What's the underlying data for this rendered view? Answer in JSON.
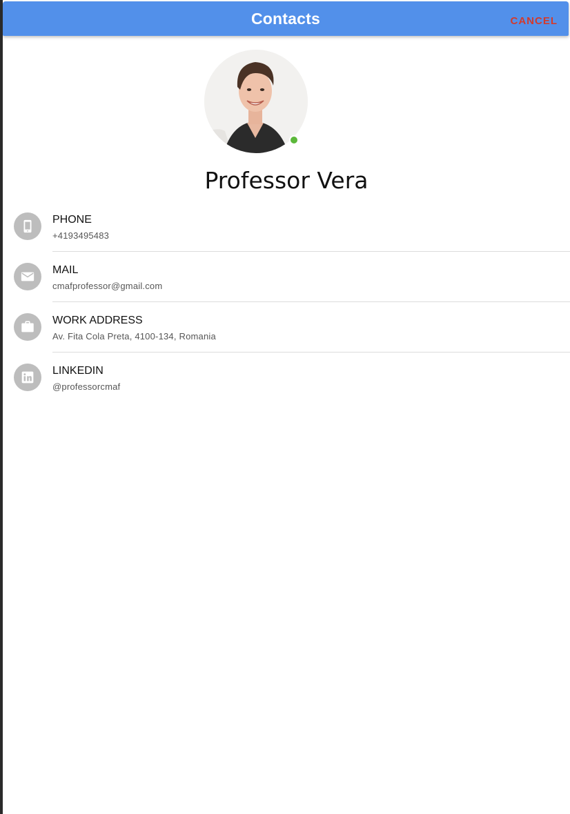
{
  "header": {
    "title": "Contacts",
    "cancel_label": "CANCEL"
  },
  "profile": {
    "name": "Professor Vera",
    "status": "online"
  },
  "contacts": [
    {
      "icon": "phone-icon",
      "label": "PHONE",
      "value": "+4193495483"
    },
    {
      "icon": "mail-icon",
      "label": "MAIL",
      "value": "cmafprofessor@gmail.com"
    },
    {
      "icon": "briefcase-icon",
      "label": "WORK ADDRESS",
      "value": "Av. Fita Cola Preta, 4100-134, Romania"
    },
    {
      "icon": "linkedin-icon",
      "label": "LINKEDIN",
      "value": "@professorcmaf"
    }
  ],
  "colors": {
    "header_bg": "#5290ea",
    "cancel": "#d33a2c",
    "icon_circle": "#bdbdbd",
    "online": "#5cb83a"
  }
}
